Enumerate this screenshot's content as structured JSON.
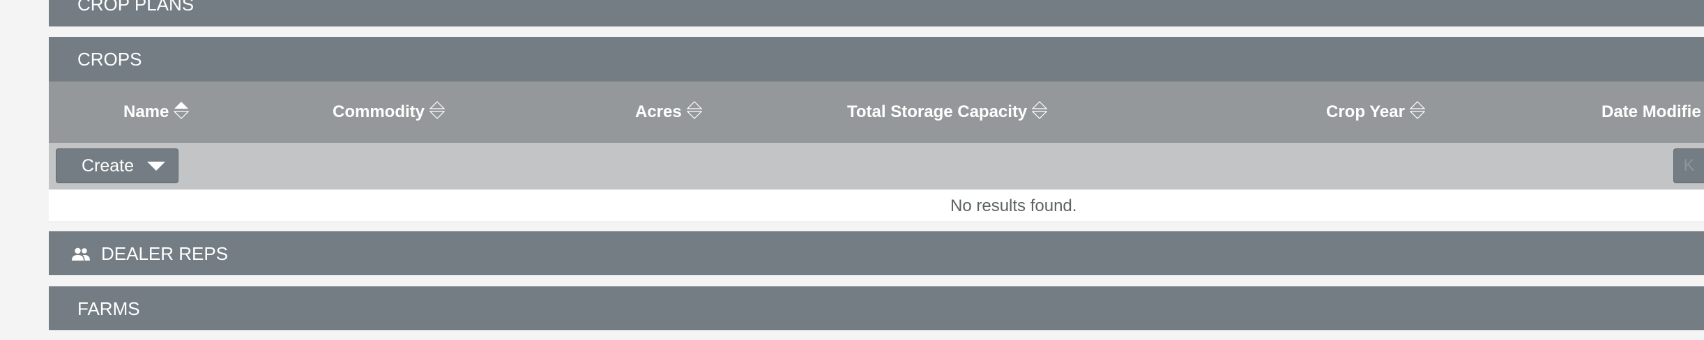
{
  "sections": {
    "crop_plans": {
      "title": "CROP PLANS"
    },
    "crops": {
      "title": "CROPS"
    },
    "dealer_reps": {
      "title": "DEALER REPS",
      "icon": "people-icon"
    },
    "farms": {
      "title": "FARMS"
    }
  },
  "crops_table": {
    "columns": [
      {
        "label": "Name",
        "sort": "ascending"
      },
      {
        "label": "Commodity",
        "sort": "none"
      },
      {
        "label": "Acres",
        "sort": "none"
      },
      {
        "label": "Total Storage Capacity",
        "sort": "none"
      },
      {
        "label": "Crop Year",
        "sort": "none"
      },
      {
        "label": "Date Modifie",
        "sort": "none"
      }
    ],
    "create_label": "Create",
    "pager_label": "K",
    "empty_message": "No results found."
  },
  "colors": {
    "section_bar": "#737d83",
    "table_header": "#94989a",
    "toolbar": "#c3c4c6",
    "page_background": "#f4f4f4"
  }
}
